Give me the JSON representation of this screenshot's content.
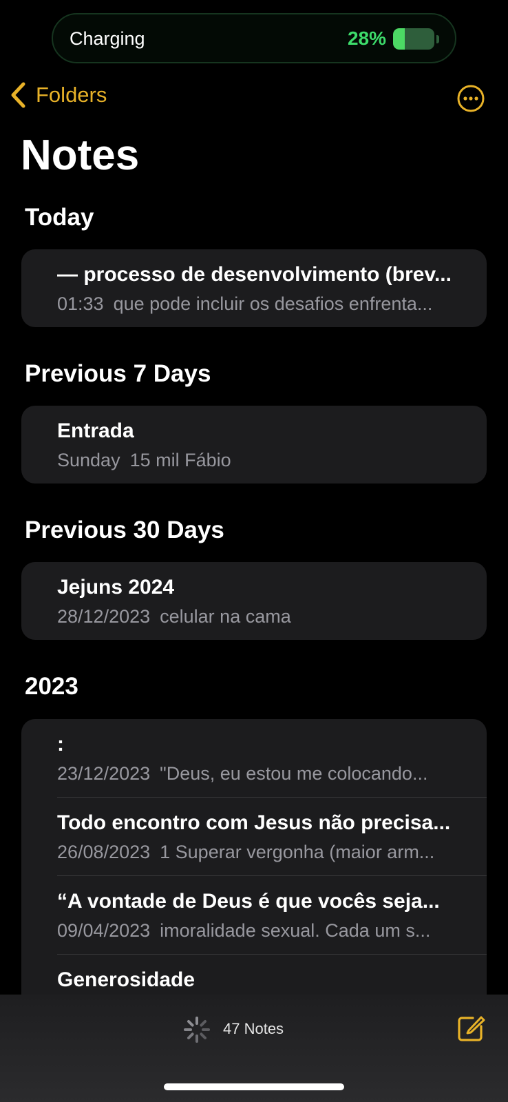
{
  "status": {
    "charging_label": "Charging",
    "battery_percent": "28%",
    "battery_level": 0.28
  },
  "nav": {
    "back_label": "Folders",
    "more_icon": "ellipsis-circle-icon"
  },
  "page": {
    "title": "Notes"
  },
  "sections": [
    {
      "header": "Today",
      "notes": [
        {
          "title": "— processo de desenvolvimento (brev...",
          "date": "01:33",
          "preview": "que pode incluir os desafios enfrenta..."
        }
      ]
    },
    {
      "header": "Previous 7 Days",
      "notes": [
        {
          "title": "Entrada",
          "date": "Sunday",
          "preview": "15 mil Fábio"
        }
      ]
    },
    {
      "header": "Previous 30 Days",
      "notes": [
        {
          "title": "Jejuns 2024",
          "date": "28/12/2023",
          "preview": "celular na cama"
        }
      ]
    },
    {
      "header": "2023",
      "notes": [
        {
          "title": ":",
          "date": "23/12/2023",
          "preview": "\"Deus, eu estou me colocando..."
        },
        {
          "title": "Todo encontro com Jesus não precisa...",
          "date": "26/08/2023",
          "preview": "1 Superar vergonha (maior arm..."
        },
        {
          "title": "“A vontade de Deus é que vocês seja...",
          "date": "09/04/2023",
          "preview": "imoralidade sexual. Cada um s..."
        },
        {
          "title": "Generosidade",
          "date": "",
          "preview": ""
        }
      ]
    }
  ],
  "footer": {
    "count_label": "47 Notes",
    "compose_icon": "compose-icon"
  },
  "colors": {
    "accent": "#e8b228",
    "card": "#1c1c1e",
    "battery_green": "#4cd964"
  }
}
